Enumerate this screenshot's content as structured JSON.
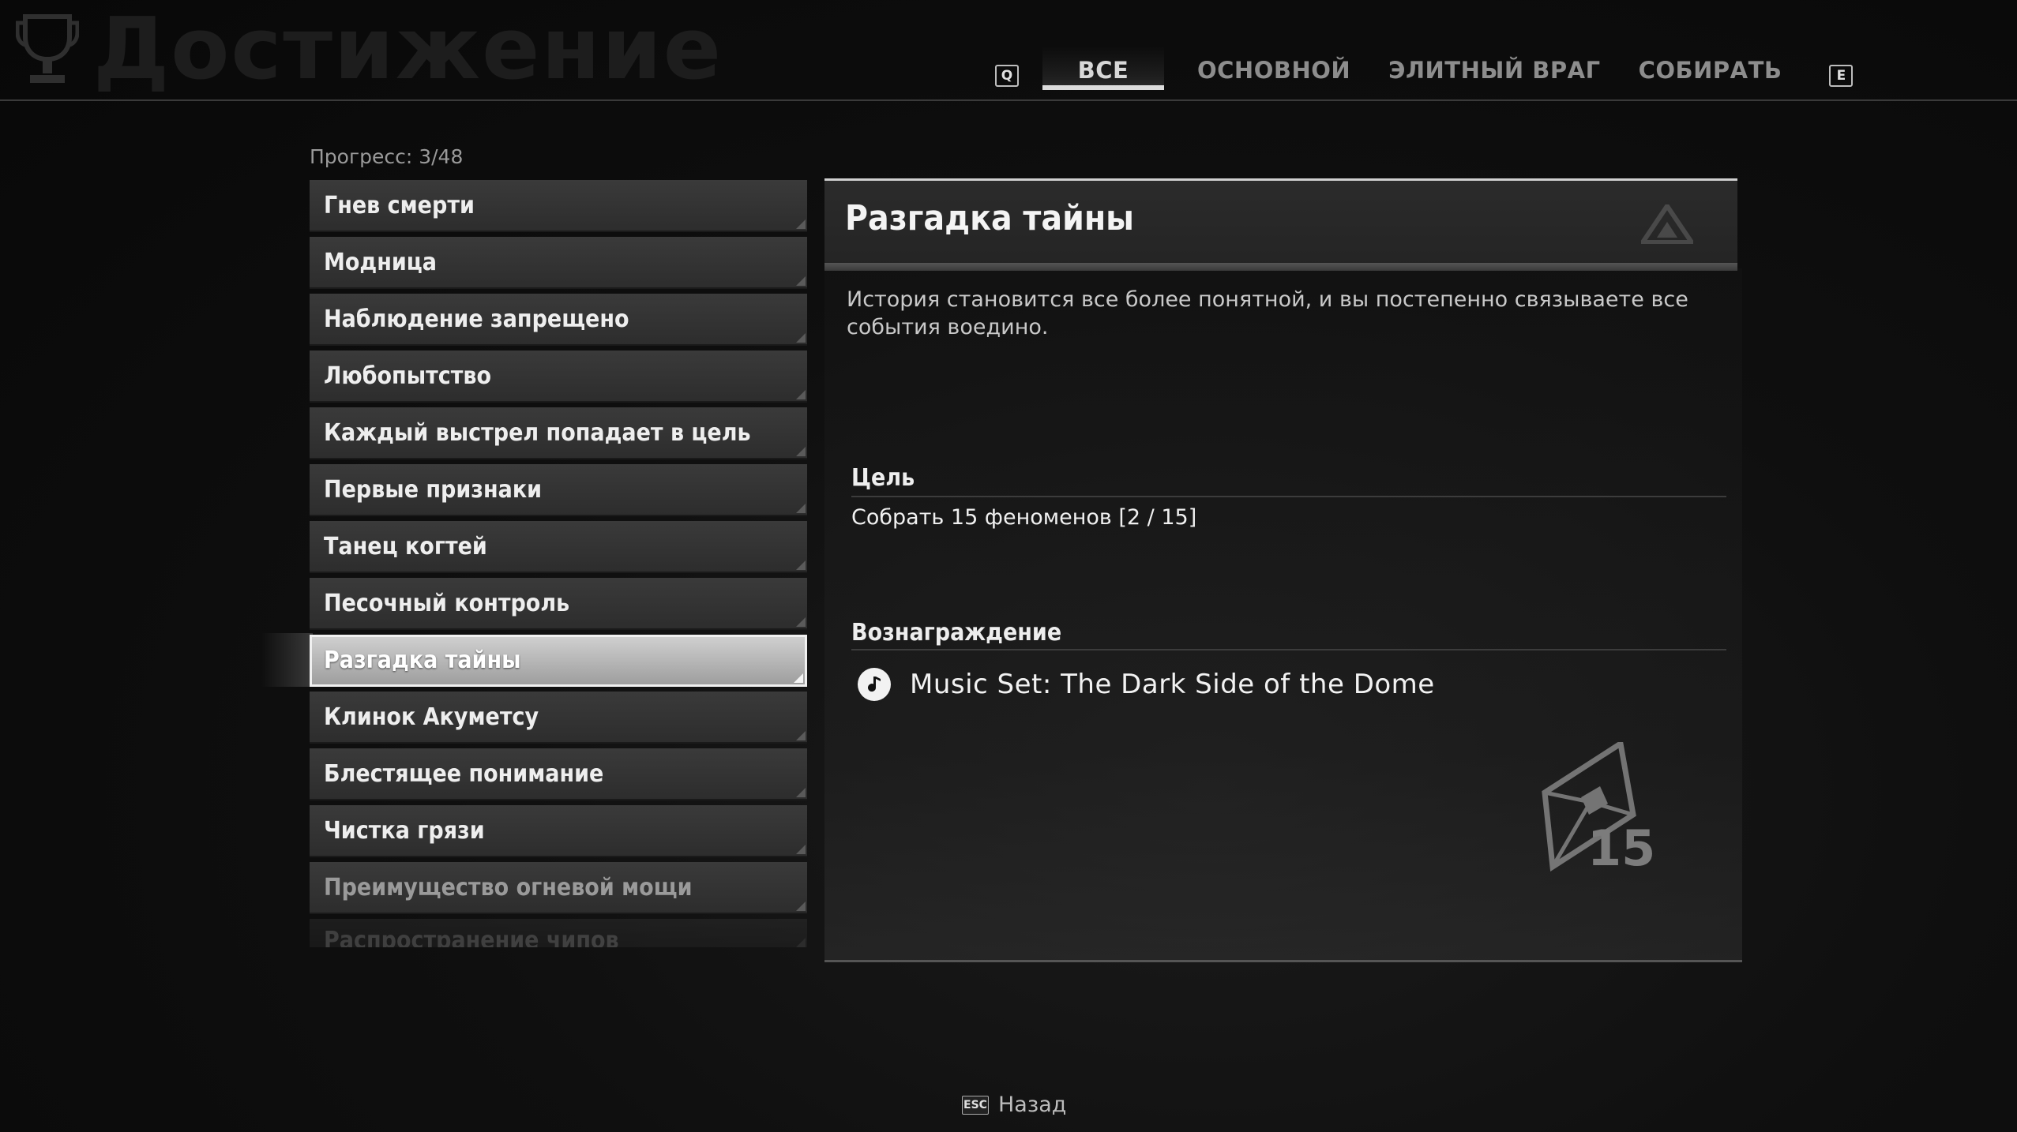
{
  "header": {
    "title": "Достижение",
    "tabs": [
      "ВСЕ",
      "ОСНОВНОЙ",
      "ЭЛИТНЫЙ ВРАГ",
      "СОБИРАТЬ"
    ],
    "active_tab": "ВСЕ",
    "key_left": "Q",
    "key_right": "E"
  },
  "progress_label": "Прогресс: 3/48",
  "achievements": [
    "Гнев смерти",
    "Модница",
    "Наблюдение запрещено",
    "Любопытство",
    "Каждый выстрел попадает в цель",
    "Первые признаки",
    "Танец когтей",
    "Песочный контроль",
    "Разгадка тайны",
    "Клинок Акуметсу",
    "Блестящее понимание",
    "Чистка грязи",
    "Преимущество огневой мощи",
    "Распространение чипов"
  ],
  "selected_index": 8,
  "detail": {
    "title": "Разгадка тайны",
    "description": "История становится все более понятной, и вы постепенно связываете все события воедино.",
    "goal_label": "Цель",
    "goal_text": "Собрать 15 феноменов [2 / 15]",
    "reward_label": "Вознаграждение",
    "reward_text": "Music Set: The Dark Side of the Dome",
    "badge_number": "15"
  },
  "footer": {
    "key": "ESC",
    "label": "Назад"
  }
}
